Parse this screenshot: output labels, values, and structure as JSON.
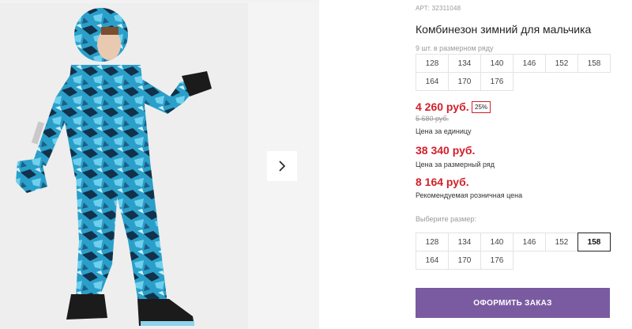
{
  "product": {
    "sku": "АРТ: 32311048",
    "title": "Комбинезон зимний для мальчика",
    "image_alt": "photo",
    "colors": {
      "print_primary": "#2a9fc9",
      "print_dark": "#12314a",
      "price_red": "#d21f2a",
      "button_purple": "#7a5ba1"
    }
  },
  "gallery": {
    "next_icon": "chevron-right-icon"
  },
  "pack": {
    "note": "9 шт. в размерном ряду",
    "sizes": [
      "128",
      "134",
      "140",
      "146",
      "152",
      "158",
      "164",
      "170",
      "176"
    ]
  },
  "prices": {
    "unit": "4 260 руб.",
    "discount": "25%",
    "old": "5 680 руб.",
    "unit_label": "Цена за единицу",
    "pack": "38 340 руб.",
    "pack_label": "Цена за размерный ряд",
    "rrp": "8 164 руб.",
    "rrp_label": "Рекомендуемая розничная цена"
  },
  "size_select": {
    "label": "Выберите размер:",
    "sizes": [
      "128",
      "134",
      "140",
      "146",
      "152",
      "158",
      "164",
      "170",
      "176"
    ],
    "selected": "158"
  },
  "order_button": {
    "label": "ОФОРМИТЬ ЗАКАЗ"
  }
}
